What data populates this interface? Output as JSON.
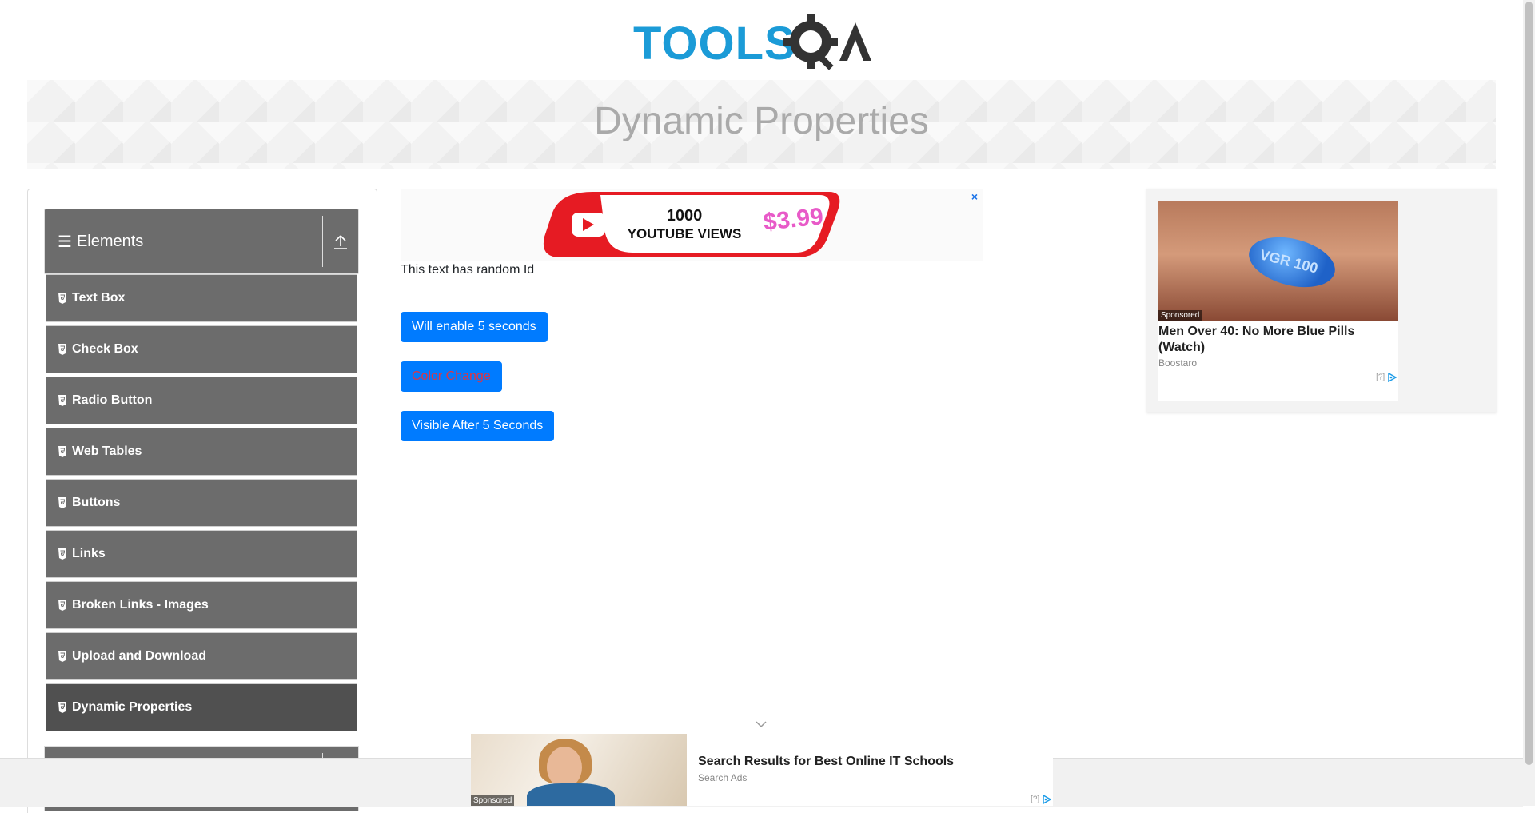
{
  "header": {
    "logo_alt": "TOOLSQA",
    "page_title": "Dynamic Properties"
  },
  "sidebar": {
    "group_title": "Elements",
    "items": [
      {
        "label": "Text Box"
      },
      {
        "label": "Check Box"
      },
      {
        "label": "Radio Button"
      },
      {
        "label": "Web Tables"
      },
      {
        "label": "Buttons"
      },
      {
        "label": "Links"
      },
      {
        "label": "Broken Links - Images"
      },
      {
        "label": "Upload and Download"
      },
      {
        "label": "Dynamic Properties",
        "active": true
      }
    ]
  },
  "main": {
    "random_text": "This text has random Id",
    "enable_button": "Will enable 5 seconds",
    "color_button": "Color Change",
    "visible_button": "Visible After 5 Seconds"
  },
  "ads": {
    "top_banner": {
      "line1": "1000",
      "line2": "YOUTUBE VIEWS",
      "price": "$3.99",
      "close": "×"
    },
    "right": {
      "tag": "Sponsored",
      "pill_text": "VGR 100",
      "headline": "Men Over 40: No More Blue Pills (Watch)",
      "source": "Boostaro",
      "info": "[?]"
    },
    "bottom": {
      "tag": "Sponsored",
      "headline": "Search Results for Best Online IT Schools",
      "source": "Search Ads",
      "info": "[?]"
    }
  },
  "colors": {
    "primary_button": "#007bff",
    "color_change_text": "#dc3545",
    "sidebar_bg": "#6c6c6c",
    "logo_blue": "#1b9bd7",
    "logo_dark": "#333333"
  }
}
